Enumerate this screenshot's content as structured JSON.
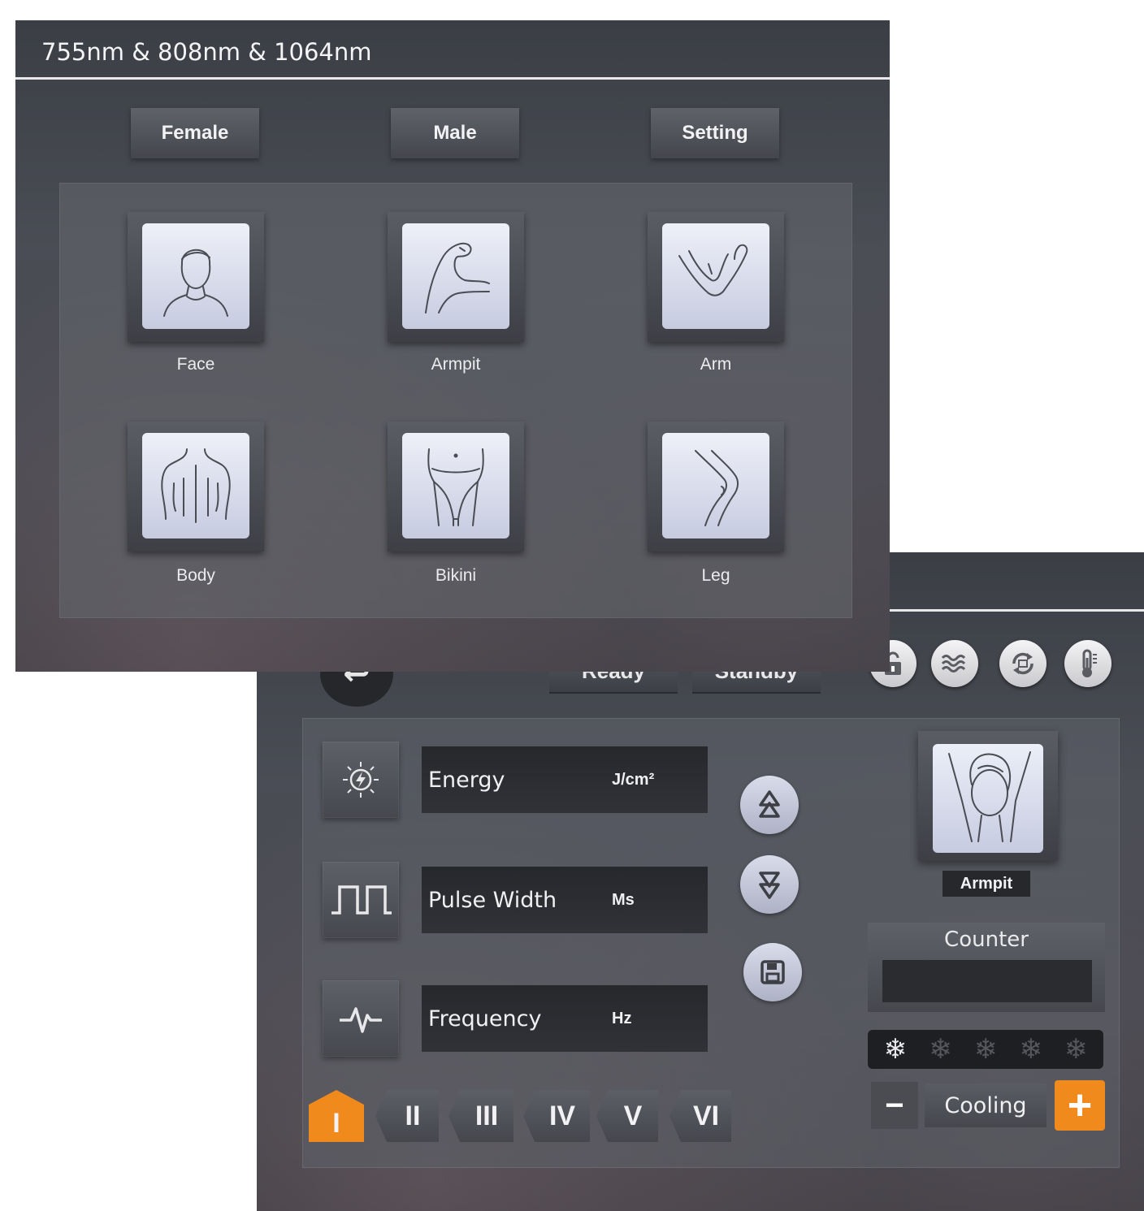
{
  "front": {
    "title": "755nm & 808nm & 1064nm",
    "tabs": [
      {
        "label": "Female"
      },
      {
        "label": "Male"
      },
      {
        "label": "Setting"
      }
    ],
    "areas": [
      {
        "label": "Face",
        "icon": "face-icon"
      },
      {
        "label": "Armpit",
        "icon": "armpit-icon"
      },
      {
        "label": "Arm",
        "icon": "arm-icon"
      },
      {
        "label": "Body",
        "icon": "body-back-icon"
      },
      {
        "label": "Bikini",
        "icon": "bikini-icon"
      },
      {
        "label": "Leg",
        "icon": "leg-icon"
      }
    ]
  },
  "back": {
    "modes": [
      {
        "label": "Ready"
      },
      {
        "label": "Standby"
      }
    ],
    "status_icons": [
      "lock-icon",
      "water-flow-icon",
      "circulation-icon",
      "thermometer-icon"
    ],
    "params": [
      {
        "label": "Energy",
        "unit": "J/cm²",
        "icon": "energy-icon"
      },
      {
        "label": "Pulse Width",
        "unit": "Ms",
        "icon": "pulse-wave-icon"
      },
      {
        "label": "Frequency",
        "unit": "Hz",
        "icon": "heartbeat-icon"
      }
    ],
    "levels": [
      "I",
      "II",
      "III",
      "IV",
      "V",
      "VI"
    ],
    "active_level": "I",
    "selected_area": "Armpit",
    "counter": {
      "title": "Counter",
      "value": ""
    },
    "cooling": {
      "label": "Cooling",
      "level": 1,
      "max": 5,
      "minus": "−",
      "plus": "+"
    },
    "colors": {
      "accent": "#f08a1c",
      "panel": "#4a4d55"
    }
  }
}
